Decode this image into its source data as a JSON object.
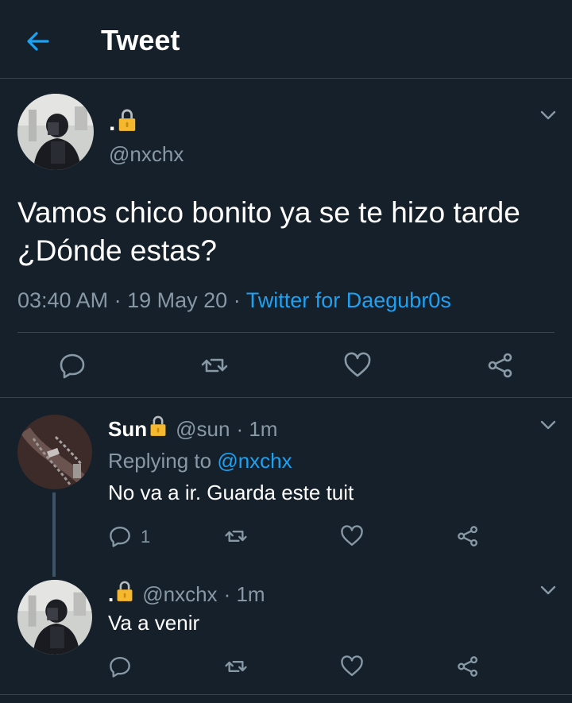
{
  "header": {
    "title": "Tweet"
  },
  "tweet": {
    "name": ".",
    "handle": "@nxchx",
    "text": "Vamos chico bonito ya se te hizo tarde ¿Dónde estas?",
    "time": "03:40 AM",
    "date": "19 May 20",
    "separator": "·",
    "source": "Twitter for Daegubr0s"
  },
  "replies": [
    {
      "name": "Sun",
      "handle": "@sun",
      "age": "· 1m",
      "replying_label": "Replying to",
      "replying_to": "@nxchx",
      "text": "No va a ir. Guarda este tuit",
      "reply_count": "1"
    },
    {
      "name": ".",
      "handle": "@nxchx",
      "age": "· 1m",
      "text": "Va a venir"
    }
  ],
  "colors": {
    "background": "#15202b",
    "accent": "#1da1f2",
    "muted": "#8899a6",
    "divider": "#38444d",
    "lock": "#f5b82e"
  },
  "icons": [
    "back-arrow-icon",
    "lock-icon",
    "chevron-down-icon",
    "reply-icon",
    "retweet-icon",
    "like-icon",
    "share-icon"
  ]
}
